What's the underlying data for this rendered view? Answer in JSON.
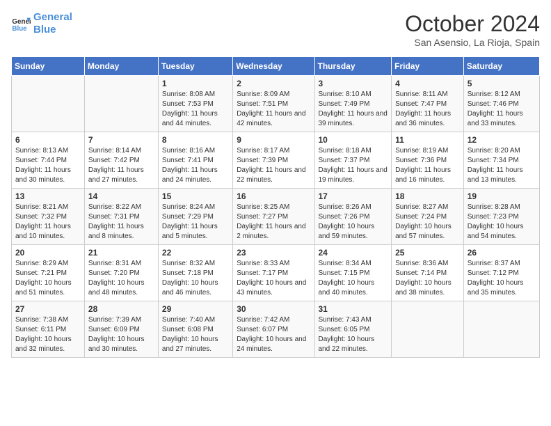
{
  "header": {
    "logo_line1": "General",
    "logo_line2": "Blue",
    "main_title": "October 2024",
    "subtitle": "San Asensio, La Rioja, Spain"
  },
  "days_of_week": [
    "Sunday",
    "Monday",
    "Tuesday",
    "Wednesday",
    "Thursday",
    "Friday",
    "Saturday"
  ],
  "weeks": [
    [
      {
        "day": "",
        "info": ""
      },
      {
        "day": "",
        "info": ""
      },
      {
        "day": "1",
        "info": "Sunrise: 8:08 AM\nSunset: 7:53 PM\nDaylight: 11 hours and 44 minutes."
      },
      {
        "day": "2",
        "info": "Sunrise: 8:09 AM\nSunset: 7:51 PM\nDaylight: 11 hours and 42 minutes."
      },
      {
        "day": "3",
        "info": "Sunrise: 8:10 AM\nSunset: 7:49 PM\nDaylight: 11 hours and 39 minutes."
      },
      {
        "day": "4",
        "info": "Sunrise: 8:11 AM\nSunset: 7:47 PM\nDaylight: 11 hours and 36 minutes."
      },
      {
        "day": "5",
        "info": "Sunrise: 8:12 AM\nSunset: 7:46 PM\nDaylight: 11 hours and 33 minutes."
      }
    ],
    [
      {
        "day": "6",
        "info": "Sunrise: 8:13 AM\nSunset: 7:44 PM\nDaylight: 11 hours and 30 minutes."
      },
      {
        "day": "7",
        "info": "Sunrise: 8:14 AM\nSunset: 7:42 PM\nDaylight: 11 hours and 27 minutes."
      },
      {
        "day": "8",
        "info": "Sunrise: 8:16 AM\nSunset: 7:41 PM\nDaylight: 11 hours and 24 minutes."
      },
      {
        "day": "9",
        "info": "Sunrise: 8:17 AM\nSunset: 7:39 PM\nDaylight: 11 hours and 22 minutes."
      },
      {
        "day": "10",
        "info": "Sunrise: 8:18 AM\nSunset: 7:37 PM\nDaylight: 11 hours and 19 minutes."
      },
      {
        "day": "11",
        "info": "Sunrise: 8:19 AM\nSunset: 7:36 PM\nDaylight: 11 hours and 16 minutes."
      },
      {
        "day": "12",
        "info": "Sunrise: 8:20 AM\nSunset: 7:34 PM\nDaylight: 11 hours and 13 minutes."
      }
    ],
    [
      {
        "day": "13",
        "info": "Sunrise: 8:21 AM\nSunset: 7:32 PM\nDaylight: 11 hours and 10 minutes."
      },
      {
        "day": "14",
        "info": "Sunrise: 8:22 AM\nSunset: 7:31 PM\nDaylight: 11 hours and 8 minutes."
      },
      {
        "day": "15",
        "info": "Sunrise: 8:24 AM\nSunset: 7:29 PM\nDaylight: 11 hours and 5 minutes."
      },
      {
        "day": "16",
        "info": "Sunrise: 8:25 AM\nSunset: 7:27 PM\nDaylight: 11 hours and 2 minutes."
      },
      {
        "day": "17",
        "info": "Sunrise: 8:26 AM\nSunset: 7:26 PM\nDaylight: 10 hours and 59 minutes."
      },
      {
        "day": "18",
        "info": "Sunrise: 8:27 AM\nSunset: 7:24 PM\nDaylight: 10 hours and 57 minutes."
      },
      {
        "day": "19",
        "info": "Sunrise: 8:28 AM\nSunset: 7:23 PM\nDaylight: 10 hours and 54 minutes."
      }
    ],
    [
      {
        "day": "20",
        "info": "Sunrise: 8:29 AM\nSunset: 7:21 PM\nDaylight: 10 hours and 51 minutes."
      },
      {
        "day": "21",
        "info": "Sunrise: 8:31 AM\nSunset: 7:20 PM\nDaylight: 10 hours and 48 minutes."
      },
      {
        "day": "22",
        "info": "Sunrise: 8:32 AM\nSunset: 7:18 PM\nDaylight: 10 hours and 46 minutes."
      },
      {
        "day": "23",
        "info": "Sunrise: 8:33 AM\nSunset: 7:17 PM\nDaylight: 10 hours and 43 minutes."
      },
      {
        "day": "24",
        "info": "Sunrise: 8:34 AM\nSunset: 7:15 PM\nDaylight: 10 hours and 40 minutes."
      },
      {
        "day": "25",
        "info": "Sunrise: 8:36 AM\nSunset: 7:14 PM\nDaylight: 10 hours and 38 minutes."
      },
      {
        "day": "26",
        "info": "Sunrise: 8:37 AM\nSunset: 7:12 PM\nDaylight: 10 hours and 35 minutes."
      }
    ],
    [
      {
        "day": "27",
        "info": "Sunrise: 7:38 AM\nSunset: 6:11 PM\nDaylight: 10 hours and 32 minutes."
      },
      {
        "day": "28",
        "info": "Sunrise: 7:39 AM\nSunset: 6:09 PM\nDaylight: 10 hours and 30 minutes."
      },
      {
        "day": "29",
        "info": "Sunrise: 7:40 AM\nSunset: 6:08 PM\nDaylight: 10 hours and 27 minutes."
      },
      {
        "day": "30",
        "info": "Sunrise: 7:42 AM\nSunset: 6:07 PM\nDaylight: 10 hours and 24 minutes."
      },
      {
        "day": "31",
        "info": "Sunrise: 7:43 AM\nSunset: 6:05 PM\nDaylight: 10 hours and 22 minutes."
      },
      {
        "day": "",
        "info": ""
      },
      {
        "day": "",
        "info": ""
      }
    ]
  ]
}
